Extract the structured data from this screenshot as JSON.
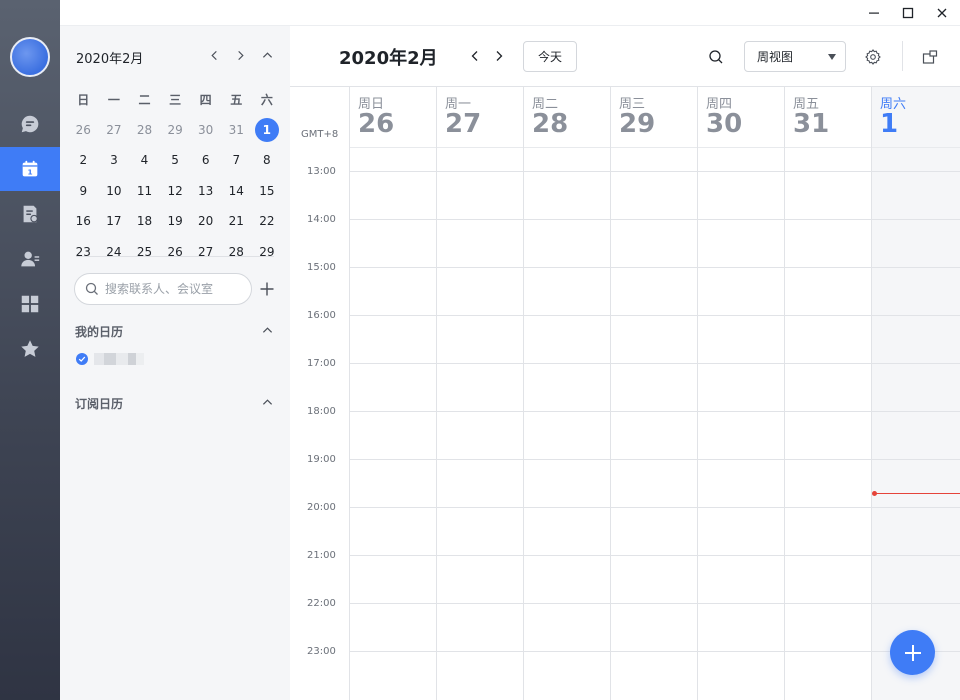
{
  "rail": {
    "items": [
      {
        "icon": "chat-icon",
        "name": "rail-item-messages"
      },
      {
        "icon": "calendar-icon",
        "name": "rail-item-calendar",
        "active": true,
        "label": "1"
      },
      {
        "icon": "document-icon",
        "name": "rail-item-docs"
      },
      {
        "icon": "contacts-icon",
        "name": "rail-item-contacts"
      },
      {
        "icon": "apps-icon",
        "name": "rail-item-workplace"
      },
      {
        "icon": "star-icon",
        "name": "rail-item-favorites"
      }
    ]
  },
  "window": {
    "minimize": "minimize-icon",
    "maximize": "maximize-icon",
    "close": "close-icon"
  },
  "mini_calendar": {
    "title": "2020年2月",
    "weekdays": [
      "日",
      "一",
      "二",
      "三",
      "四",
      "五",
      "六"
    ],
    "weeks": [
      [
        "26",
        "27",
        "28",
        "29",
        "30",
        "31",
        "1"
      ],
      [
        "2",
        "3",
        "4",
        "5",
        "6",
        "7",
        "8"
      ],
      [
        "9",
        "10",
        "11",
        "12",
        "13",
        "14",
        "15"
      ],
      [
        "16",
        "17",
        "18",
        "19",
        "20",
        "21",
        "22"
      ],
      [
        "23",
        "24",
        "25",
        "26",
        "27",
        "28",
        "29"
      ]
    ],
    "today": "1"
  },
  "search": {
    "placeholder": "搜索联系人、会议室"
  },
  "sections": {
    "my_calendars": "我的日历",
    "subscribed": "订阅日历"
  },
  "header": {
    "title": "2020年2月",
    "today_label": "今天",
    "view_label": "周视图"
  },
  "week": {
    "timezone": "GMT+8",
    "days": [
      {
        "name": "周日",
        "num": "26"
      },
      {
        "name": "周一",
        "num": "27"
      },
      {
        "name": "周二",
        "num": "28"
      },
      {
        "name": "周三",
        "num": "29"
      },
      {
        "name": "周四",
        "num": "30"
      },
      {
        "name": "周五",
        "num": "31"
      },
      {
        "name": "周六",
        "num": "1",
        "current": true
      }
    ],
    "hours": [
      "13:00",
      "14:00",
      "15:00",
      "16:00",
      "17:00",
      "18:00",
      "19:00",
      "20:00",
      "21:00",
      "22:00",
      "23:00"
    ]
  },
  "colors": {
    "accent": "#3f7cf6",
    "now_line": "#e5443a",
    "rail_top": "#5a6270",
    "rail_bottom": "#2f3443"
  }
}
